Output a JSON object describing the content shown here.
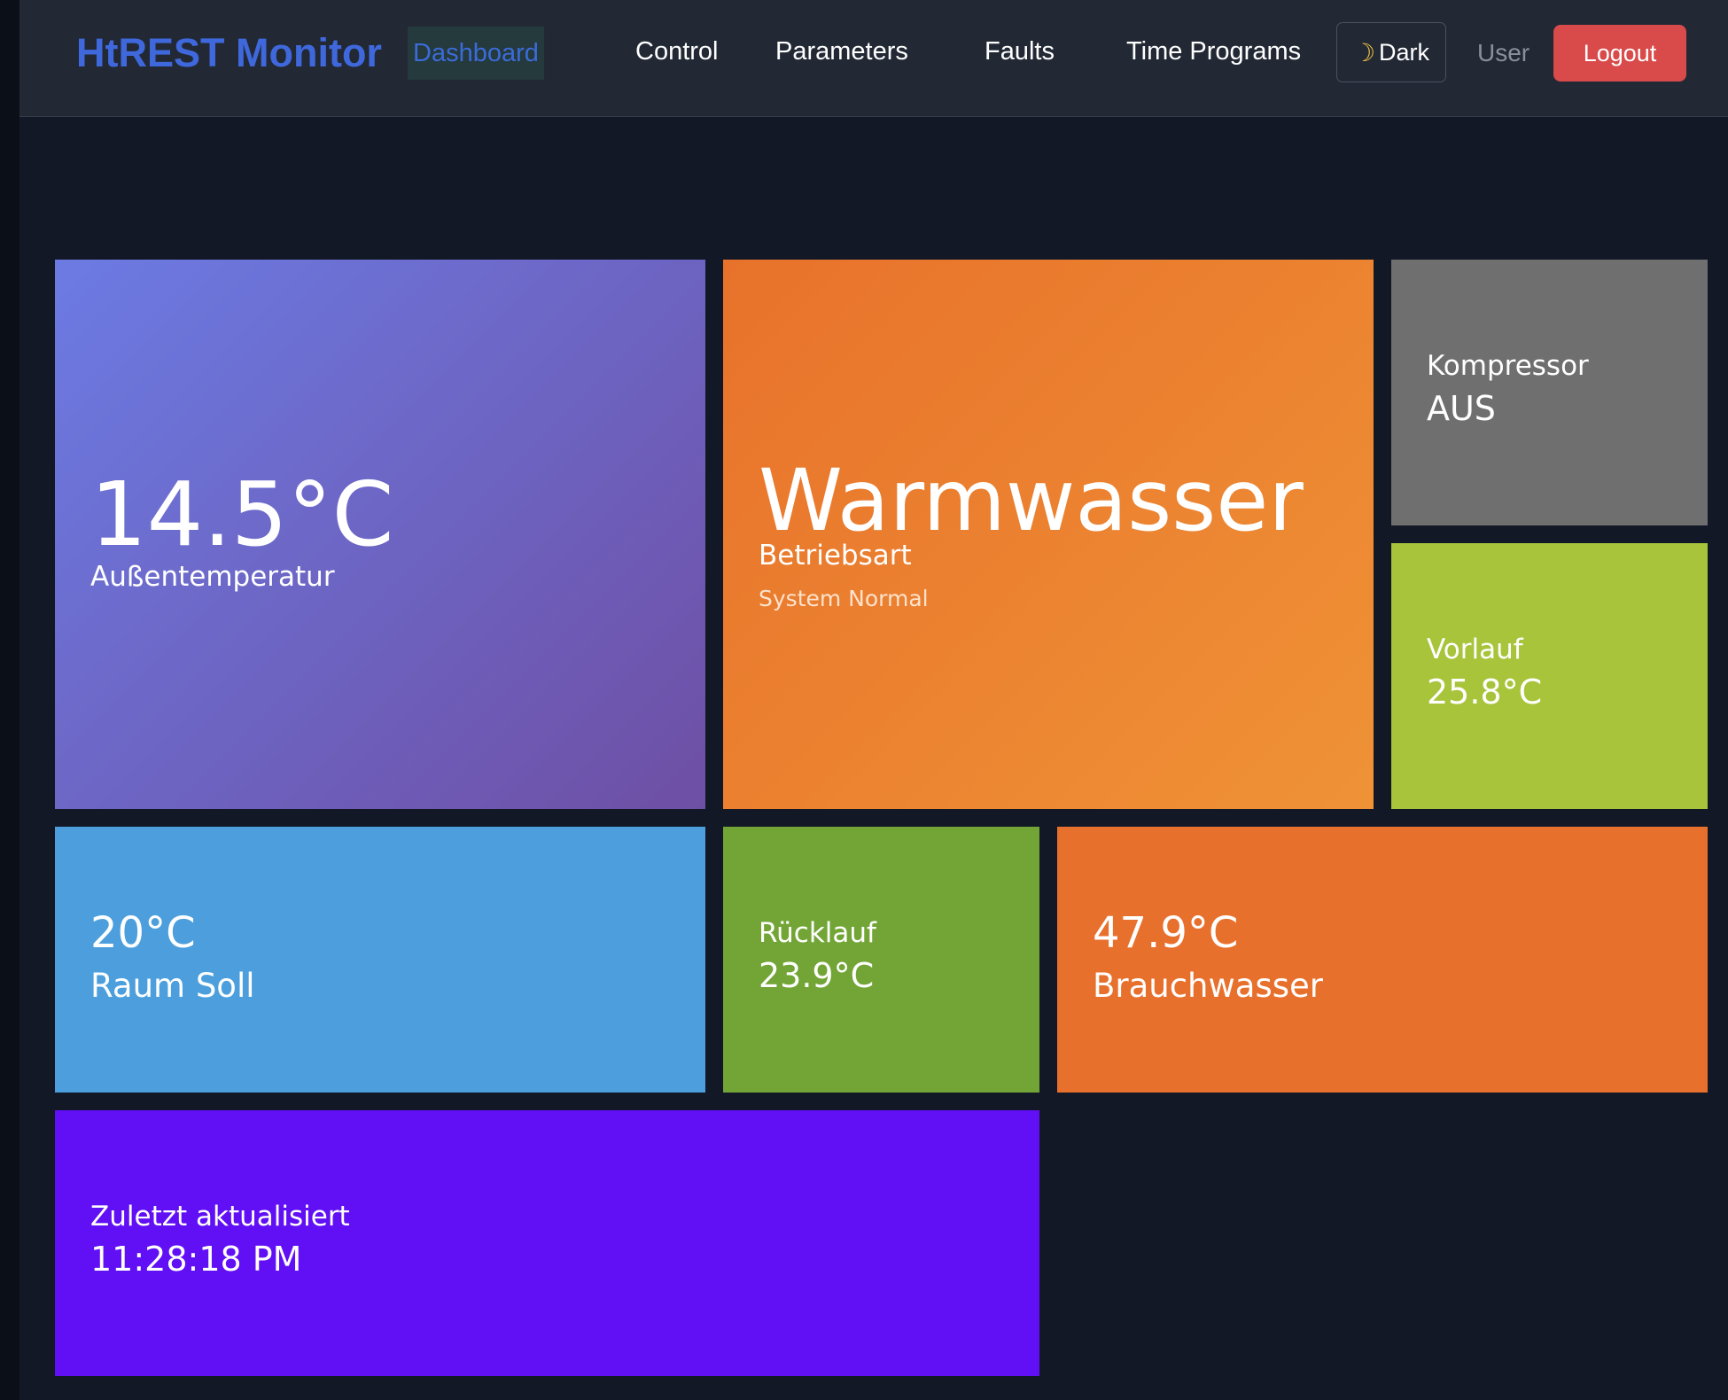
{
  "navbar": {
    "brand": "HtREST Monitor",
    "links": [
      "Dashboard",
      "Control",
      "Parameters",
      "Faults",
      "Time Programs"
    ],
    "active": "Dashboard",
    "theme_toggle": {
      "icon": "moon-icon",
      "label": "Dark"
    },
    "user": "User",
    "logout": "Logout"
  },
  "tiles": {
    "outdoor": {
      "value": "14.5°C",
      "label": "Außentemperatur"
    },
    "mode": {
      "value": "Warmwasser",
      "label": "Betriebsart",
      "sub": "System Normal"
    },
    "compressor": {
      "label": "Kompressor",
      "value": "AUS"
    },
    "vorlauf": {
      "label": "Vorlauf",
      "value": "25.8°C"
    },
    "raum": {
      "value": "20°C",
      "label": "Raum Soll"
    },
    "ruecklauf": {
      "label": "Rücklauf",
      "value": "23.9°C"
    },
    "brauchwasser": {
      "value": "47.9°C",
      "label": "Brauchwasser"
    },
    "updated": {
      "label": "Zuletzt aktualisiert",
      "value": "11:28:18 PM"
    }
  },
  "colors": {
    "navbar_bg": "#222935",
    "page_bg": "#121826",
    "brand": "#3f68dc",
    "logout": "#d94a4a",
    "outdoor_tile": "#6c7be3",
    "mode_tile": "#ec8232",
    "compressor_tile": "#6f6f6f",
    "vorlauf_tile": "#a8c43b",
    "raum_tile": "#4c9fdc",
    "ruecklauf_tile": "#72a536",
    "brauchwasser_tile": "#e8702d",
    "updated_tile": "#610ff4"
  }
}
